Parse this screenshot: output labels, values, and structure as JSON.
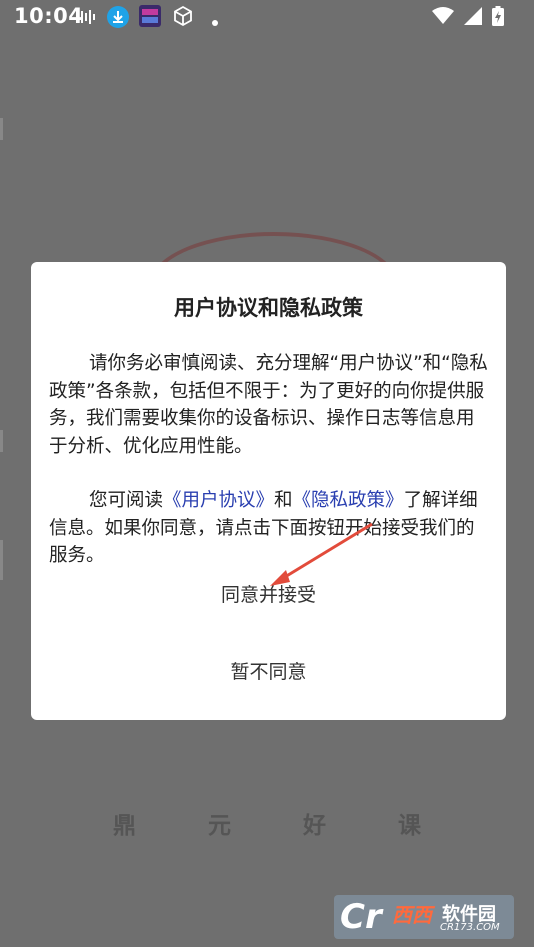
{
  "status_bar": {
    "time": "10:04",
    "icons_left": [
      "audio-wave-icon",
      "download-icon",
      "app-thumbnail-icon",
      "cube-icon",
      "dot-icon"
    ],
    "icons_right": [
      "wifi-icon",
      "signal-icon",
      "battery-charging-icon"
    ]
  },
  "background": {
    "app_title": "鼎 元 好 课"
  },
  "dialog": {
    "title": "用户协议和隐私政策",
    "para1": "请你务必审慎阅读、充分理解“用户协议”和“隐私政策”各条款，包括但不限于：为了更好的向你提供服务，我们需要收集你的设备标识、操作日志等信息用于分析、优化应用性能。",
    "para2_prefix": "您可阅读",
    "link_user_agreement": "《用户协议》",
    "para2_and": "和",
    "link_privacy_policy": "《隐私政策》",
    "para2_suffix": "了解详细信息。如果你同意，请点击下面按钮开始接受我们的服务。",
    "agree_button": "同意并接受",
    "decline_button": "暂不同意"
  },
  "watermark": {
    "logo": "Cr",
    "name_colored": "西西",
    "name_white": "软件园",
    "url": "CR173.COM"
  },
  "colors": {
    "overlay": "#6f6f6f",
    "link": "#2a3fb0",
    "arrow": "#e24b3b"
  }
}
